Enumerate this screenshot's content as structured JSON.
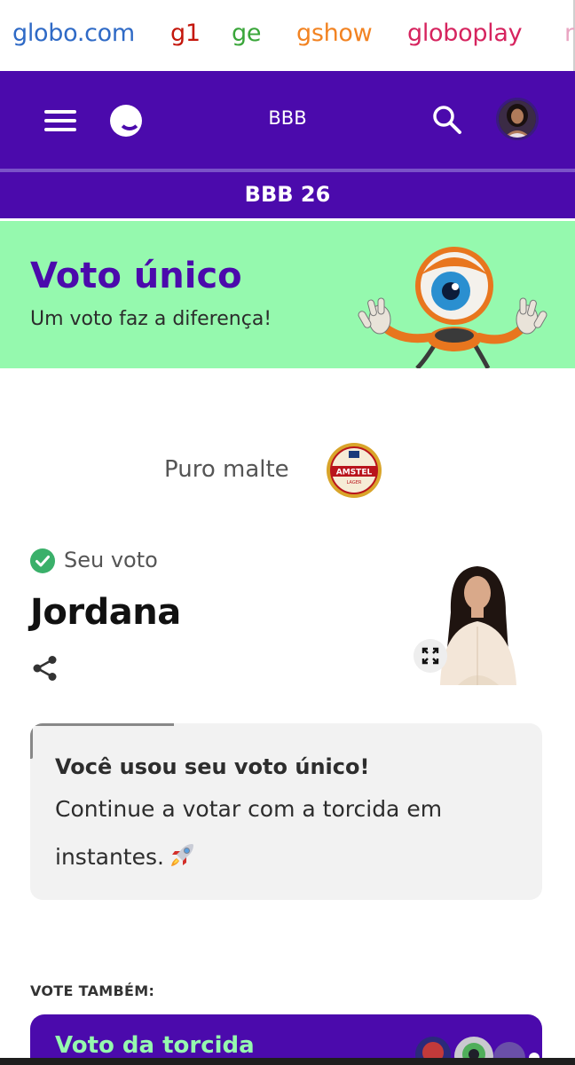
{
  "brands": {
    "globo": {
      "label": "globo.com",
      "color": "#2f6ac6"
    },
    "g1": {
      "label": "g1",
      "color": "#c4170c"
    },
    "ge": {
      "label": "ge",
      "color": "#3aa63a"
    },
    "gshow": {
      "label": "gshow",
      "color": "#f28322"
    },
    "globoplay": {
      "label": "globoplay",
      "color": "#d6245f"
    },
    "more": {
      "label": "r",
      "color": "#e9a5c2"
    }
  },
  "header": {
    "title": "BBB",
    "menu_icon": "hamburger-menu-icon",
    "logo_icon": "globo-smile-logo",
    "search_icon": "search-icon",
    "avatar_icon": "user-avatar",
    "color": "#4b0aac"
  },
  "program": {
    "title": "BBB 26"
  },
  "banner": {
    "title": "Voto único",
    "subtitle": "Um voto faz a diferença!",
    "mascot_icon": "big-brother-eye-mascot",
    "background": "#95f9ae"
  },
  "sponsor": {
    "text": "Puro malte",
    "logo_text": "AMSTEL",
    "logo_sub": "LAGER"
  },
  "vote": {
    "status_label": "Seu voto",
    "candidate": "Jordana",
    "check_icon": "check-circle-icon",
    "share_icon": "share-icon",
    "expand_icon": "expand-icon"
  },
  "info": {
    "title": "Você usou seu voto único!",
    "line1": "Continue a votar com a torcida em",
    "line2": "instantes."
  },
  "also": {
    "label": "VOTE TAMBÉM:",
    "card_title": "Voto da torcida"
  }
}
